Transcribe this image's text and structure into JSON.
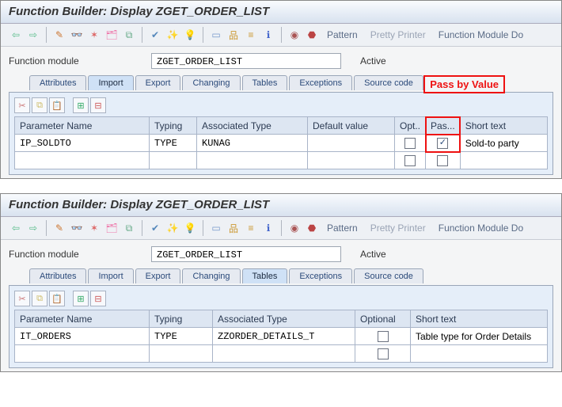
{
  "title": "Function Builder: Display ZGET_ORDER_LIST",
  "toolbar": {
    "pattern": "Pattern",
    "pretty": "Pretty Printer",
    "fmdoc": "Function Module Do"
  },
  "form": {
    "fm_label": "Function module",
    "fm_value": "ZGET_ORDER_LIST",
    "status": "Active"
  },
  "tabs": {
    "attributes": "Attributes",
    "import": "Import",
    "export": "Export",
    "changing": "Changing",
    "tables": "Tables",
    "exceptions": "Exceptions",
    "source": "Source code"
  },
  "annotation": {
    "pass_by_value": "Pass by Value"
  },
  "import_table": {
    "headers": {
      "param": "Parameter Name",
      "typing": "Typing",
      "assoc": "Associated Type",
      "default": "Default value",
      "opt": "Opt..",
      "pass": "Pas...",
      "short": "Short text"
    },
    "rows": [
      {
        "param": "IP_SOLDTO",
        "typing": "TYPE",
        "assoc": "KUNAG",
        "default": "",
        "opt": false,
        "pass": true,
        "short": "Sold-to party"
      }
    ]
  },
  "tables_table": {
    "headers": {
      "param": "Parameter Name",
      "typing": "Typing",
      "assoc": "Associated Type",
      "optional": "Optional",
      "short": "Short text"
    },
    "rows": [
      {
        "param": "IT_ORDERS",
        "typing": "TYPE",
        "assoc": "ZZORDER_DETAILS_T",
        "optional": false,
        "short": "Table type for Order Details"
      }
    ]
  }
}
